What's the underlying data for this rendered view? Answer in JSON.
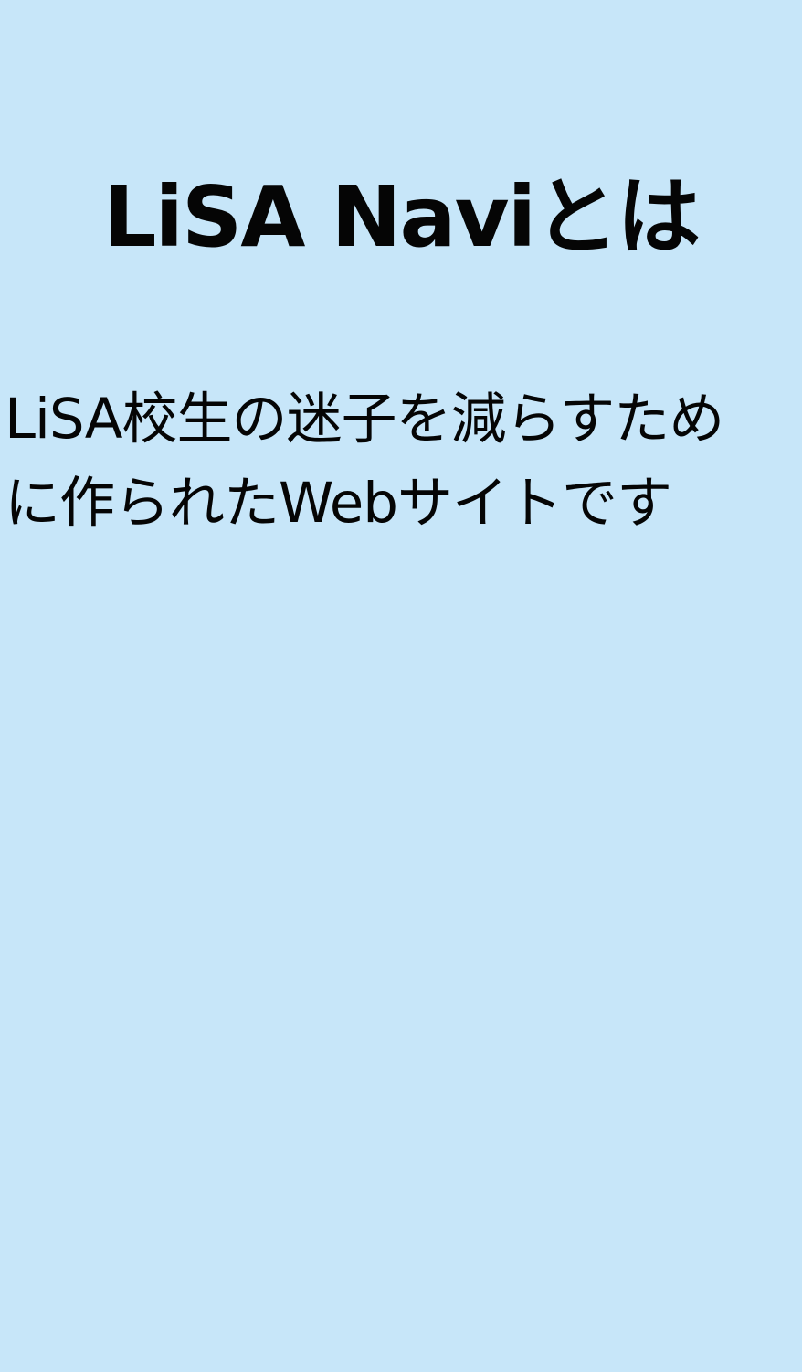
{
  "page": {
    "background_color": "#c7e6f9",
    "title": "LiSA Naviとは",
    "description_lines": [
      "LiSA校生の迷子を減らすため",
      "に作られたWebサイトです"
    ]
  }
}
